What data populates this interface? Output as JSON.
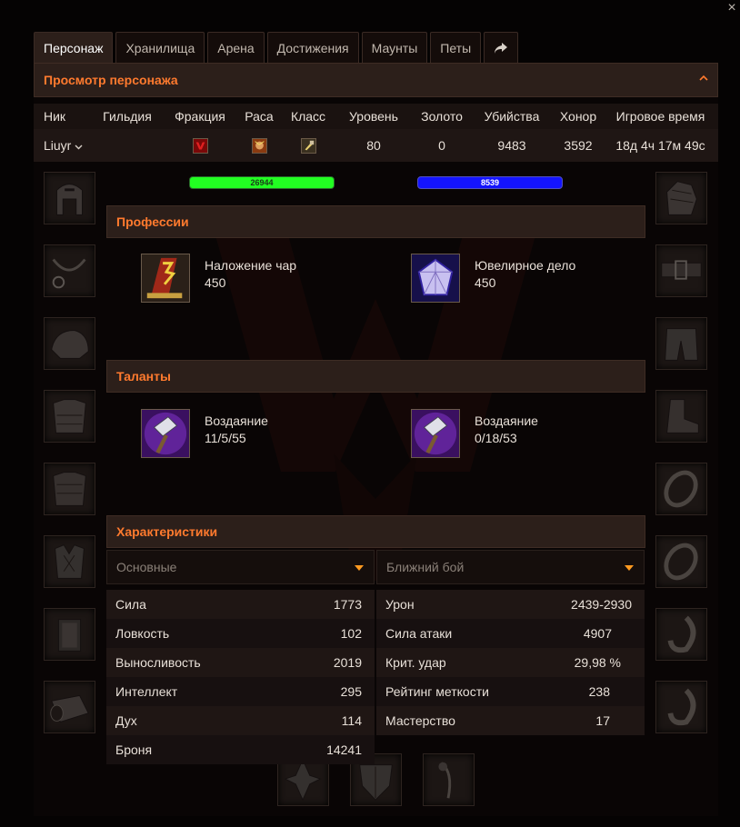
{
  "window": {
    "close_label": "×"
  },
  "tabs": [
    {
      "label": "Персонаж"
    },
    {
      "label": "Хранилища"
    },
    {
      "label": "Арена"
    },
    {
      "label": "Достижения"
    },
    {
      "label": "Маунты"
    },
    {
      "label": "Петы"
    }
  ],
  "share_icon": "share-icon",
  "character_view": {
    "title": "Просмотр персонажа"
  },
  "table": {
    "headers": [
      "Ник",
      "Гильдия",
      "Фракция",
      "Раса",
      "Класс",
      "Уровень",
      "Золото",
      "Убийства",
      "Хонор",
      "Игровое время"
    ],
    "row": {
      "name": "Liuyr",
      "guild": "",
      "faction_icon": "horde-icon",
      "race_icon": "blood-elf-icon",
      "class_icon": "paladin-icon",
      "level": "80",
      "gold": "0",
      "kills": "9483",
      "honor": "3592",
      "played": "18д 4ч 17м 49с"
    }
  },
  "bars": {
    "health": "26944",
    "mana": "8539"
  },
  "professions": {
    "title": "Профессии",
    "items": [
      {
        "name": "Наложение чар",
        "value": "450",
        "icon": "enchanting-icon"
      },
      {
        "name": "Ювелирное дело",
        "value": "450",
        "icon": "jewelcrafting-icon"
      }
    ]
  },
  "talents": {
    "title": "Таланты",
    "items": [
      {
        "name": "Воздаяние",
        "value": "11/5/55",
        "icon": "retribution-hammer-icon"
      },
      {
        "name": "Воздаяние",
        "value": "0/18/53",
        "icon": "retribution-hammer-icon"
      }
    ]
  },
  "stats": {
    "title": "Характеристики",
    "left": {
      "selected": "Основные",
      "rows": [
        {
          "label": "Сила",
          "value": "1773"
        },
        {
          "label": "Ловкость",
          "value": "102"
        },
        {
          "label": "Выносливость",
          "value": "2019"
        },
        {
          "label": "Интеллект",
          "value": "295"
        },
        {
          "label": "Дух",
          "value": "114"
        },
        {
          "label": "Броня",
          "value": "14241"
        }
      ]
    },
    "right": {
      "selected": "Ближний бой",
      "rows": [
        {
          "label": "Урон",
          "value": "2439-2930"
        },
        {
          "label": "Сила атаки",
          "value": "4907"
        },
        {
          "label": "Крит. удар",
          "value": "29,98 %"
        },
        {
          "label": "Рейтинг меткости",
          "value": "238"
        },
        {
          "label": "Мастерство",
          "value": "17"
        }
      ]
    }
  },
  "colors": {
    "accent": "#ff7a2e",
    "health": "#22ff22",
    "mana": "#1414ff",
    "header_bg": "#2c1f1a"
  }
}
